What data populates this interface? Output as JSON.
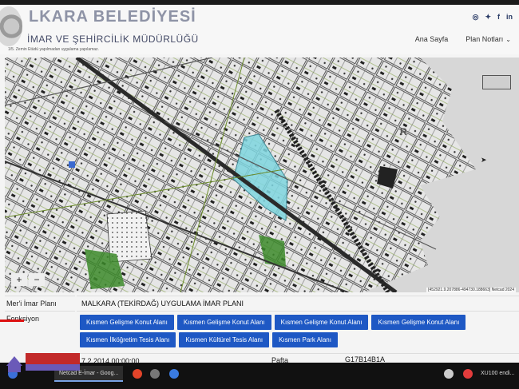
{
  "header": {
    "org_title": "MALKARA BELEDİYESİ",
    "org_title_visible": "LKARA BELEDİYESİ",
    "dept_title": "İMAR VE ŞEHİRCİLİK MÜDÜRLÜĞÜ",
    "notice": "1/5. Zemin Etüdü yapılmadan uygulama yapılamaz.",
    "social_icons": [
      "instagram-icon",
      "twitter-icon",
      "facebook-icon",
      "linkedin-icon"
    ],
    "social_glyphs": [
      "◎",
      "✦",
      "f",
      "in"
    ],
    "nav": [
      {
        "label": "Ana Sayfa",
        "dropdown": false
      },
      {
        "label": "Plan Notları",
        "dropdown": true
      }
    ]
  },
  "map": {
    "controls": {
      "zoom_in": "+",
      "zoom_out": "−"
    },
    "credit": "[452921.9.207886-494730.188663] Netcad 2024",
    "compass_letter": "R"
  },
  "info": {
    "plan_label": "Mer'i İmar Planı",
    "plan_value": "MALKARA (TEKİRDAĞ) UYGULAMA İMAR PLANI",
    "function_label": "Fonksiyon",
    "functions": [
      "Kısmen Gelişme Konut Alanı",
      "Kısmen Gelişme Konut Alanı",
      "Kısmen Gelişme Konut Alanı",
      "Kısmen Gelişme Konut Alanı",
      "Kısmen İlköğretim Tesis Alanı",
      "Kısmen Kültürel Tesis Alanı",
      "Kısmen Park Alanı"
    ],
    "date_value": "7.2.2014 00:00:00",
    "pafta_label": "Pafta",
    "pafta_value": "G17B14B1A"
  },
  "taskbar": {
    "active_window": "Netcad E-İmar - Goog...",
    "tray_text": "XU100 endi..."
  },
  "colors": {
    "button_blue": "#1e58c4",
    "highlight_parcel": "#7fd6e0",
    "road_dark": "#2a2a2a"
  }
}
